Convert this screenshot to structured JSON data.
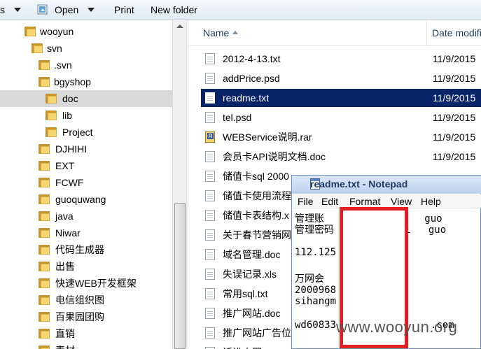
{
  "toolbar": {
    "organize_label": "s",
    "open_label": "Open",
    "print_label": "Print",
    "new_folder_label": "New folder"
  },
  "tree": {
    "items": [
      {
        "label": "wooyun"
      },
      {
        "label": "svn"
      },
      {
        "label": ".svn"
      },
      {
        "label": "bgyshop"
      },
      {
        "label": "doc"
      },
      {
        "label": "lib"
      },
      {
        "label": "Project"
      },
      {
        "label": "DJHIHI"
      },
      {
        "label": "EXT"
      },
      {
        "label": "FCWF"
      },
      {
        "label": "guoquwang"
      },
      {
        "label": "java"
      },
      {
        "label": "Niwar"
      },
      {
        "label": "代码生成器"
      },
      {
        "label": "出售"
      },
      {
        "label": "快速WEB开发框架"
      },
      {
        "label": "电信组织图"
      },
      {
        "label": "百果园团购"
      },
      {
        "label": "直销"
      },
      {
        "label": "素材"
      }
    ],
    "selected": "doc"
  },
  "columns": {
    "name": "Name",
    "date": "Date modified"
  },
  "files": [
    {
      "name": "2012-4-13.txt",
      "date": "11/9/2015",
      "icon": "text-file-icon"
    },
    {
      "name": "addPrice.psd",
      "date": "11/9/2015",
      "icon": "psd-file-icon"
    },
    {
      "name": "readme.txt",
      "date": "11/9/2015",
      "icon": "text-file-icon"
    },
    {
      "name": "tel.psd",
      "date": "11/9/2015",
      "icon": "psd-file-icon"
    },
    {
      "name": "WEBService说明.rar",
      "date": "11/9/2015",
      "icon": "rar-file-icon"
    },
    {
      "name": "会员卡API说明文档.doc",
      "date": "11/9/2015",
      "icon": "doc-file-icon"
    },
    {
      "name": "储值卡sql 2000",
      "date": "",
      "icon": "file-icon"
    },
    {
      "name": "储值卡使用流程",
      "date": "",
      "icon": "file-icon"
    },
    {
      "name": "储值卡表结构.x",
      "date": "",
      "icon": "file-icon"
    },
    {
      "name": "关于春节营销网",
      "date": "",
      "icon": "file-icon"
    },
    {
      "name": "域名管理.doc",
      "date": "",
      "icon": "doc-file-icon"
    },
    {
      "name": "失误记录.xls",
      "date": "",
      "icon": "xls-file-icon"
    },
    {
      "name": "常用sql.txt",
      "date": "",
      "icon": "text-file-icon"
    },
    {
      "name": "推广网站.doc",
      "date": "",
      "icon": "doc-file-icon"
    },
    {
      "name": "推广网站广告位",
      "date": "",
      "icon": "file-icon"
    },
    {
      "name": "诉讼内网",
      "date": "",
      "icon": "file-icon"
    }
  ],
  "selected_file": "readme.txt",
  "notepad": {
    "title": "readme.txt - Notepad",
    "menu": [
      "File",
      "Edit",
      "Format",
      "View",
      "Help"
    ],
    "lines": [
      "管理账         33adm   guo",
      "管理密码        j6k4i   guo",
      "",
      "112.125",
      "",
      "万网会",
      "2000968",
      "sihangm",
      "",
      "wd60833                .com"
    ]
  },
  "watermark": "www.wooyun.org",
  "colors": {
    "selection": "#0a246a",
    "tree_selection": "#d9d9d9",
    "redaction_box": "#e31e24"
  }
}
